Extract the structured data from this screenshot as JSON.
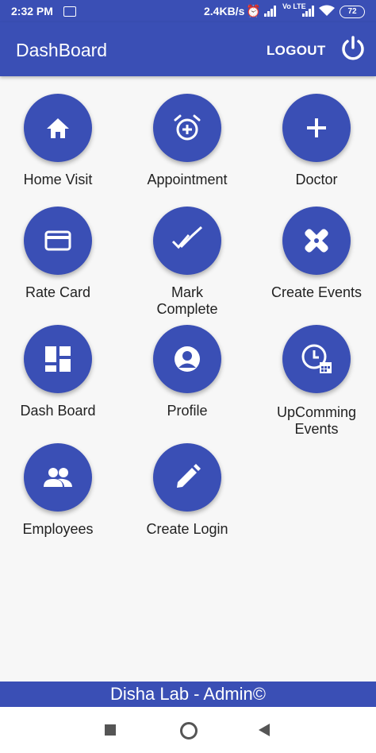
{
  "status_bar": {
    "time": "2:32 PM",
    "speed": "2.4KB/s",
    "volte": "Vo LTE",
    "battery": "72"
  },
  "app_bar": {
    "title": "DashBoard",
    "logout_label": "LOGOUT"
  },
  "tiles": [
    {
      "label": "Home Visit",
      "icon": "home-icon"
    },
    {
      "label": "Appointment",
      "icon": "alarm-add-icon"
    },
    {
      "label": "Doctor",
      "icon": "plus-icon"
    },
    {
      "label": "Rate Card",
      "icon": "credit-card-icon"
    },
    {
      "label": "Mark Complete",
      "icon": "done-all-icon"
    },
    {
      "label": "Create Events",
      "icon": "bandage-icon"
    },
    {
      "label": "Dash Board",
      "icon": "dashboard-icon"
    },
    {
      "label": "Profile",
      "icon": "account-circle-icon"
    },
    {
      "label": "UpComming Events",
      "icon": "clock-calendar-icon"
    },
    {
      "label": "Employees",
      "icon": "people-icon"
    },
    {
      "label": "Create Login",
      "icon": "pencil-icon"
    }
  ],
  "footer": {
    "text": "Disha Lab - Admin©"
  },
  "colors": {
    "primary": "#3a4fb5",
    "background": "#f7f7f7"
  }
}
